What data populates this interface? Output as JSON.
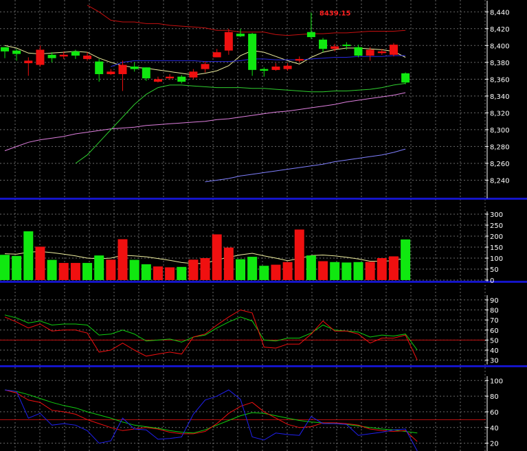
{
  "colors": {
    "background": "#000000",
    "grid": "#6b6b6b",
    "separator": "#1414c8",
    "up": "#10e810",
    "down": "#f01010",
    "price_ma_fast": "#f0f0a0",
    "price_ma_mid": "#2828e0",
    "price_ma_slow": "#e080e0",
    "price_ma_long": "#30d030",
    "price_ma_longest": "#8080ff",
    "bollinger": "#c81010",
    "volume_ma": "#f0f0a0",
    "osc_line_1": "#10d010",
    "osc_line_2": "#f01010",
    "osc_line_3": "#2020f0",
    "osc_midline": "#c01010"
  },
  "chart_data": [
    {
      "type": "candlestick",
      "panel": "price",
      "ylim": [
        8220,
        8450
      ],
      "yticks": [
        8240,
        8260,
        8280,
        8300,
        8320,
        8340,
        8360,
        8380,
        8400,
        8420,
        8440
      ],
      "tick_labels": [
        "8,240",
        "8,260",
        "8,280",
        "8,300",
        "8,320",
        "8,340",
        "8,360",
        "8,380",
        "8,400",
        "8,420",
        "8,440"
      ],
      "annotation": {
        "text": "8439.15",
        "index": 26,
        "value": 8439.15
      },
      "candles": [
        {
          "o": 8393,
          "h": 8398,
          "l": 8385,
          "c": 8398,
          "dir": "up"
        },
        {
          "o": 8390,
          "h": 8396,
          "l": 8382,
          "c": 8394,
          "dir": "up"
        },
        {
          "o": 8382,
          "h": 8386,
          "l": 8364,
          "c": 8379,
          "dir": "down"
        },
        {
          "o": 8395,
          "h": 8400,
          "l": 8375,
          "c": 8377,
          "dir": "down"
        },
        {
          "o": 8385,
          "h": 8392,
          "l": 8380,
          "c": 8389,
          "dir": "up"
        },
        {
          "o": 8389,
          "h": 8393,
          "l": 8384,
          "c": 8387,
          "dir": "down"
        },
        {
          "o": 8388,
          "h": 8395,
          "l": 8384,
          "c": 8393,
          "dir": "up"
        },
        {
          "o": 8388,
          "h": 8392,
          "l": 8382,
          "c": 8384,
          "dir": "down"
        },
        {
          "o": 8366,
          "h": 8384,
          "l": 8357,
          "c": 8381,
          "dir": "up"
        },
        {
          "o": 8369,
          "h": 8372,
          "l": 8365,
          "c": 8366,
          "dir": "down"
        },
        {
          "o": 8377,
          "h": 8382,
          "l": 8346,
          "c": 8366,
          "dir": "down"
        },
        {
          "o": 8375,
          "h": 8380,
          "l": 8369,
          "c": 8372,
          "dir": "up"
        },
        {
          "o": 8361,
          "h": 8374,
          "l": 8358,
          "c": 8374,
          "dir": "up"
        },
        {
          "o": 8360,
          "h": 8363,
          "l": 8356,
          "c": 8357,
          "dir": "down"
        },
        {
          "o": 8363,
          "h": 8366,
          "l": 8359,
          "c": 8361,
          "dir": "down"
        },
        {
          "o": 8357,
          "h": 8365,
          "l": 8355,
          "c": 8363,
          "dir": "up"
        },
        {
          "o": 8369,
          "h": 8372,
          "l": 8360,
          "c": 8362,
          "dir": "down"
        },
        {
          "o": 8378,
          "h": 8381,
          "l": 8368,
          "c": 8372,
          "dir": "down"
        },
        {
          "o": 8392,
          "h": 8396,
          "l": 8386,
          "c": 8386,
          "dir": "down"
        },
        {
          "o": 8416,
          "h": 8420,
          "l": 8389,
          "c": 8394,
          "dir": "down"
        },
        {
          "o": 8411,
          "h": 8420,
          "l": 8410,
          "c": 8414,
          "dir": "up"
        },
        {
          "o": 8371,
          "h": 8415,
          "l": 8364,
          "c": 8414,
          "dir": "up"
        },
        {
          "o": 8370,
          "h": 8374,
          "l": 8363,
          "c": 8372,
          "dir": "up"
        },
        {
          "o": 8375,
          "h": 8379,
          "l": 8370,
          "c": 8371,
          "dir": "down"
        },
        {
          "o": 8376,
          "h": 8379,
          "l": 8370,
          "c": 8372,
          "dir": "down"
        },
        {
          "o": 8384,
          "h": 8387,
          "l": 8380,
          "c": 8382,
          "dir": "down"
        },
        {
          "o": 8410,
          "h": 8439.15,
          "l": 8408,
          "c": 8416,
          "dir": "up"
        },
        {
          "o": 8396,
          "h": 8409,
          "l": 8392,
          "c": 8407,
          "dir": "up"
        },
        {
          "o": 8399,
          "h": 8402,
          "l": 8393,
          "c": 8396,
          "dir": "down"
        },
        {
          "o": 8400,
          "h": 8404,
          "l": 8395,
          "c": 8401,
          "dir": "up"
        },
        {
          "o": 8388,
          "h": 8401,
          "l": 8386,
          "c": 8398,
          "dir": "up"
        },
        {
          "o": 8395,
          "h": 8398,
          "l": 8382,
          "c": 8388,
          "dir": "down"
        },
        {
          "o": 8393,
          "h": 8396,
          "l": 8389,
          "c": 8391,
          "dir": "down"
        },
        {
          "o": 8401,
          "h": 8403,
          "l": 8387,
          "c": 8389,
          "dir": "down"
        },
        {
          "o": 8356,
          "h": 8368,
          "l": 8354,
          "c": 8367,
          "dir": "up"
        }
      ],
      "overlays": [
        {
          "key": "price_ma_fast",
          "values": [
            8400,
            8397,
            8391,
            8390,
            8391,
            8392,
            8393,
            8392,
            8385,
            8380,
            8376,
            8374,
            8373,
            8371,
            8369,
            8367,
            8365,
            8367,
            8370,
            8376,
            8388,
            8394,
            8392,
            8387,
            8382,
            8378,
            8386,
            8392,
            8395,
            8397,
            8397,
            8396,
            8395,
            8393,
            8386
          ]
        },
        {
          "key": "price_ma_mid",
          "values": [
            null,
            null,
            null,
            null,
            null,
            null,
            null,
            null,
            null,
            8375,
            8380,
            8382,
            8382,
            8382,
            8382,
            8382,
            8382,
            8381,
            8381,
            8381,
            8382,
            8384,
            8384,
            8383,
            8383,
            8383,
            8384,
            8385,
            8386,
            8386,
            8387,
            8387,
            8387,
            8388,
            8388
          ]
        },
        {
          "key": "price_ma_slow",
          "values": [
            8275,
            8280,
            8285,
            8288,
            8290,
            8292,
            8295,
            8297,
            8299,
            8301,
            8302,
            8303,
            8305,
            8306,
            8307,
            8308,
            8309,
            8310,
            8312,
            8313,
            8315,
            8317,
            8319,
            8321,
            8322,
            8324,
            8326,
            8328,
            8330,
            8333,
            8335,
            8337,
            8339,
            8341,
            8344
          ]
        },
        {
          "key": "price_ma_long",
          "values": [
            null,
            null,
            null,
            null,
            null,
            null,
            8260,
            8270,
            8285,
            8300,
            8315,
            8330,
            8342,
            8350,
            8353,
            8353,
            8352,
            8351,
            8350,
            8350,
            8350,
            8349,
            8349,
            8348,
            8347,
            8346,
            8345,
            8345,
            8346,
            8346,
            8347,
            8348,
            8350,
            8353,
            8355
          ]
        },
        {
          "key": "price_ma_longest",
          "values": [
            null,
            null,
            null,
            null,
            null,
            null,
            null,
            null,
            null,
            null,
            null,
            null,
            null,
            null,
            null,
            null,
            null,
            8238,
            8240,
            8242,
            8245,
            8247,
            8249,
            8251,
            8253,
            8255,
            8257,
            8259,
            8262,
            8264,
            8266,
            8268,
            8270,
            8273,
            8277
          ]
        },
        {
          "key": "bollinger",
          "values": [
            null,
            null,
            null,
            null,
            null,
            null,
            null,
            8448,
            8440,
            8430,
            8428,
            8428,
            8426,
            8426,
            8424,
            8423,
            8422,
            8421,
            8418,
            8418,
            8416,
            8416,
            8416,
            8413,
            8412,
            8413,
            8414,
            8414,
            8415,
            8415,
            8416,
            8417,
            8417,
            8417,
            8418
          ]
        }
      ]
    },
    {
      "type": "bar",
      "panel": "volume",
      "ylim": [
        0,
        300
      ],
      "yticks": [
        0,
        50,
        100,
        150,
        200,
        250,
        300
      ],
      "tick_labels": [
        "0",
        "50",
        "100",
        "150",
        "200",
        "250",
        "300"
      ],
      "values": [
        115,
        110,
        222,
        152,
        92,
        78,
        78,
        78,
        112,
        93,
        186,
        92,
        72,
        62,
        58,
        60,
        93,
        100,
        208,
        148,
        95,
        106,
        65,
        70,
        82,
        230,
        112,
        86,
        82,
        80,
        82,
        83,
        100,
        108,
        185
      ],
      "directions": [
        "up",
        "up",
        "up",
        "down",
        "up",
        "down",
        "down",
        "up",
        "up",
        "down",
        "down",
        "up",
        "up",
        "down",
        "down",
        "up",
        "down",
        "down",
        "down",
        "down",
        "up",
        "up",
        "up",
        "down",
        "down",
        "down",
        "up",
        "down",
        "up",
        "up",
        "up",
        "down",
        "down",
        "down",
        "up"
      ],
      "overlay": {
        "key": "volume_ma",
        "values": [
          120,
          118,
          127,
          130,
          125,
          118,
          110,
          100,
          97,
          100,
          113,
          110,
          106,
          98,
          90,
          80,
          75,
          76,
          92,
          104,
          115,
          122,
          110,
          100,
          88,
          98,
          112,
          114,
          110,
          104,
          96,
          86,
          86,
          88,
          100
        ]
      }
    },
    {
      "type": "line",
      "panel": "oscillator_1",
      "ylim": [
        27,
        92
      ],
      "yticks": [
        30,
        40,
        50,
        60,
        70,
        80,
        90
      ],
      "tick_labels": [
        "30",
        "40",
        "50",
        "60",
        "70",
        "80",
        "90"
      ],
      "midline": 50,
      "series": [
        {
          "key": "osc_line_1",
          "values": [
            75,
            72,
            67,
            69,
            65,
            66,
            66,
            65,
            55,
            56,
            60,
            56,
            49,
            50,
            51,
            48,
            53,
            55,
            62,
            68,
            73,
            69,
            50,
            49,
            52,
            52,
            57,
            65,
            60,
            59,
            58,
            53,
            55,
            54,
            56
          ]
        },
        {
          "key": "osc_line_2",
          "values": [
            73,
            68,
            62,
            66,
            59,
            60,
            60,
            57,
            38,
            40,
            47,
            40,
            34,
            36,
            38,
            36,
            53,
            56,
            65,
            73,
            80,
            77,
            43,
            42,
            46,
            46,
            56,
            69,
            59,
            59,
            56,
            47,
            52,
            52,
            55
          ]
        }
      ],
      "last_values": [
        40,
        30
      ]
    },
    {
      "type": "line",
      "panel": "oscillator_2",
      "ylim": [
        10,
        102
      ],
      "yticks": [
        20,
        40,
        60,
        80,
        100
      ],
      "tick_labels": [
        "20",
        "40",
        "60",
        "80",
        "100"
      ],
      "midline": 50,
      "series": [
        {
          "key": "osc_line_1",
          "values": [
            88,
            86,
            82,
            77,
            72,
            68,
            65,
            60,
            56,
            52,
            47,
            43,
            41,
            39,
            36,
            34,
            33,
            37,
            43,
            49,
            55,
            59,
            58,
            55,
            52,
            49,
            47,
            46,
            45,
            44,
            42,
            40,
            38,
            37,
            35,
            33
          ]
        },
        {
          "key": "osc_line_2",
          "values": [
            88,
            84,
            75,
            72,
            62,
            60,
            57,
            50,
            45,
            40,
            36,
            38,
            40,
            38,
            34,
            32,
            32,
            35,
            45,
            58,
            67,
            72,
            60,
            52,
            44,
            40,
            41,
            46,
            46,
            45,
            43,
            38,
            36,
            35,
            36,
            22
          ]
        },
        {
          "key": "osc_line_3",
          "values": [
            88,
            86,
            52,
            58,
            43,
            45,
            43,
            36,
            20,
            23,
            52,
            38,
            37,
            25,
            26,
            28,
            57,
            75,
            80,
            88,
            76,
            28,
            24,
            33,
            31,
            30,
            54,
            45,
            45,
            44,
            30,
            32,
            34,
            37,
            38,
            10
          ]
        }
      ]
    }
  ]
}
